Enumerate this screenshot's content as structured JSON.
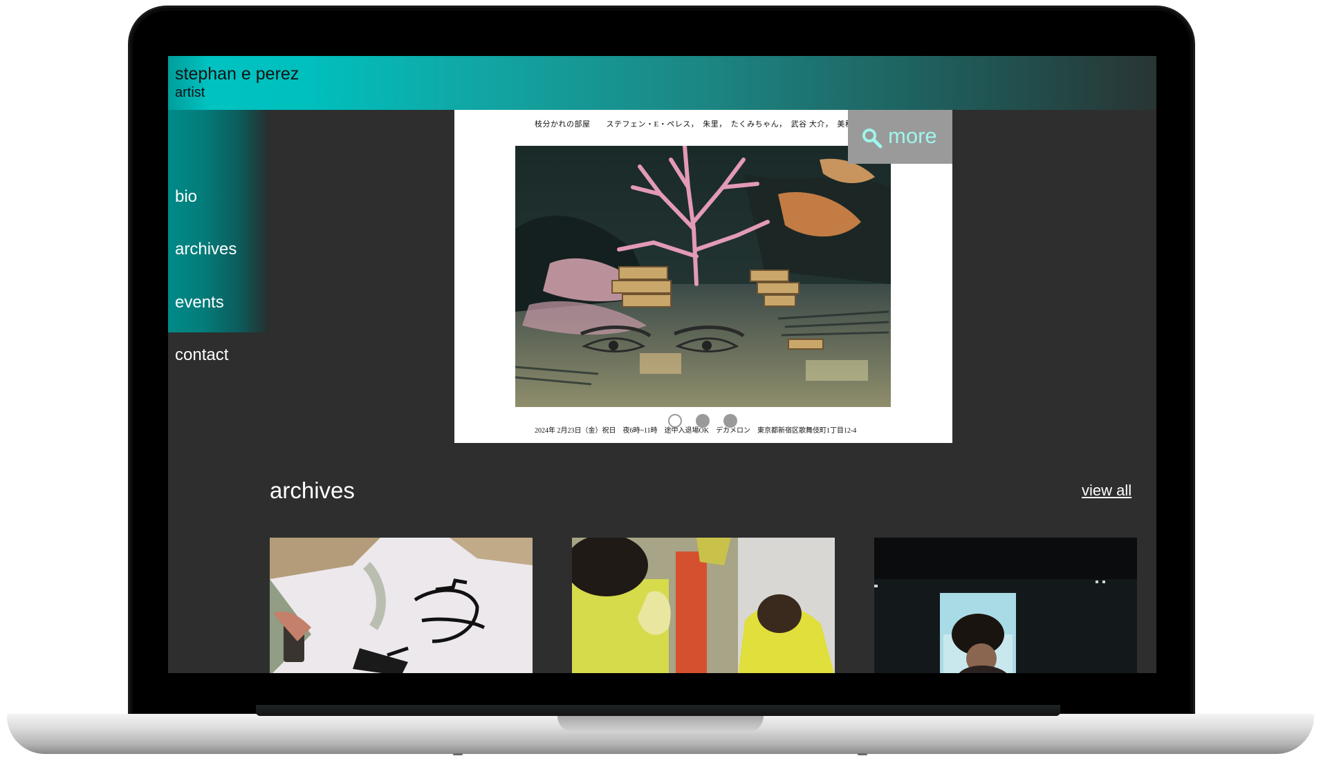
{
  "site": {
    "name": "stephan e perez",
    "subtitle": "artist"
  },
  "nav": {
    "items": [
      {
        "label": "bio"
      },
      {
        "label": "archives"
      },
      {
        "label": "events"
      },
      {
        "label": "contact"
      }
    ]
  },
  "slideshow": {
    "poster_top": "枝分かれの部屋　　ステフェン・E・ペレス，　朱里，　たくみちゃん，　武谷 大介，　美秋 Meerkat",
    "poster_bottom": "2024年 2月23日（金）祝日　夜6時~11時　途中入退場OK　デカメロン　東京都新宿区歌舞伎町1丁目12-4",
    "more_label": "more",
    "more_icon": "search-icon",
    "dots": [
      {
        "state": "active"
      },
      {
        "state": "inactive"
      },
      {
        "state": "inactive"
      }
    ]
  },
  "archives": {
    "title": "archives",
    "view_all_label": "view all",
    "thumbnails": [
      {
        "subject": "ink drawing of a masked face"
      },
      {
        "subject": "performers in yellow"
      },
      {
        "subject": "figure lit in a dark doorway"
      }
    ]
  },
  "colors": {
    "accent_teal": "#00c2c0",
    "page_background": "#2e2e2e",
    "more_text": "#9ef6ec"
  }
}
